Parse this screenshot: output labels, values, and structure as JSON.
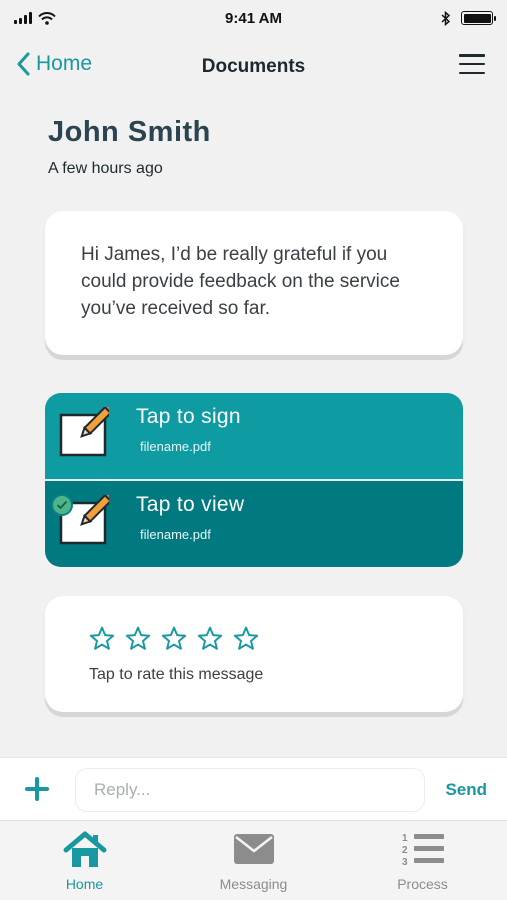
{
  "status_bar": {
    "time": "9:41 AM"
  },
  "nav": {
    "back_label": "Home",
    "title": "Documents"
  },
  "message": {
    "sender": "John Smith",
    "time": "A few hours ago",
    "text": "Hi James, I’d be really grateful if you could provide feedback on the service you’ve received so far."
  },
  "documents": [
    {
      "action": "Tap to sign",
      "filename": "filename.pdf"
    },
    {
      "action": "Tap to view",
      "filename": "filename.pdf"
    }
  ],
  "rating": {
    "hint": "Tap to rate this message",
    "stars_total": 5
  },
  "reply": {
    "placeholder": "Reply...",
    "send_label": "Send"
  },
  "tabs": [
    {
      "label": "Home"
    },
    {
      "label": "Messaging"
    },
    {
      "label": "Process"
    }
  ],
  "colors": {
    "accent": "#1a98a1",
    "sign_row": "#0f9ba2",
    "view_row": "#007a80",
    "check": "#4cb58a"
  }
}
